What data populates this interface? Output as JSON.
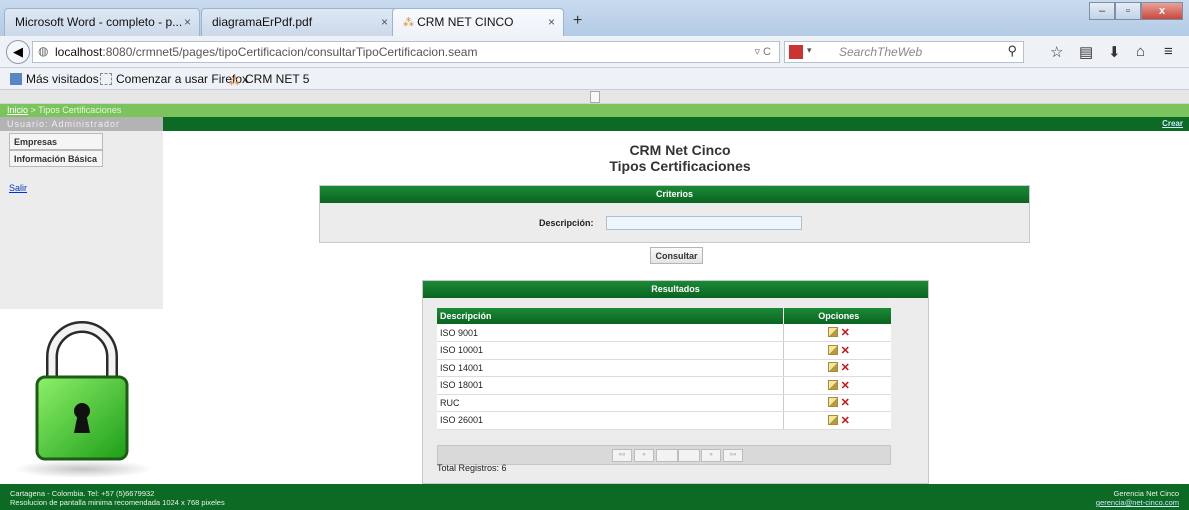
{
  "browser": {
    "tabs": [
      {
        "label": "Microsoft Word - completo - p...",
        "close": "×"
      },
      {
        "label": "diagramaErPdf.pdf",
        "close": "×"
      },
      {
        "label": "CRM NET CINCO",
        "close": "×"
      }
    ],
    "new_tab": "+",
    "url_host": "localhost",
    "url_rest": ":8080/crmnet5/pages/tipoCertificacion/consultarTipoCertificacion.seam",
    "search_placeholder": "SearchTheWeb",
    "bookmarks": [
      "Más visitados",
      "Comenzar a usar Firefox",
      "CRM NET 5"
    ]
  },
  "app": {
    "breadcrumb_home": "Inicio",
    "breadcrumb_sep": " > ",
    "breadcrumb_current": "Tipos Certificaciones",
    "user_label": "Usuario: Administrador",
    "crear": "Crear",
    "menu": [
      "Empresas",
      "Información Básica"
    ],
    "salir": "Salir",
    "title_line1": "CRM Net Cinco",
    "title_line2": "Tipos Certificaciones",
    "criteria": {
      "header": "Criterios",
      "label": "Descripción:",
      "value": ""
    },
    "consultar": "Consultar",
    "results": {
      "header": "Resultados",
      "col_desc": "Descripción",
      "col_opts": "Opciones",
      "rows": [
        "ISO 9001",
        "ISO 10001",
        "ISO 14001",
        "ISO 18001",
        "RUC",
        "ISO 26001"
      ],
      "pager": [
        "««",
        "«",
        "»",
        "»»"
      ],
      "total": "Total Registros: 6"
    }
  },
  "footer": {
    "line1": "Cartagena - Colombia. Tel: +57 (5)6679932",
    "line2": "Resolucion de pantalla minima recomendada 1024 x 768 pixeles",
    "company": "Gerencia Net Cinco",
    "email": "gerencia@net-cinco.com"
  }
}
